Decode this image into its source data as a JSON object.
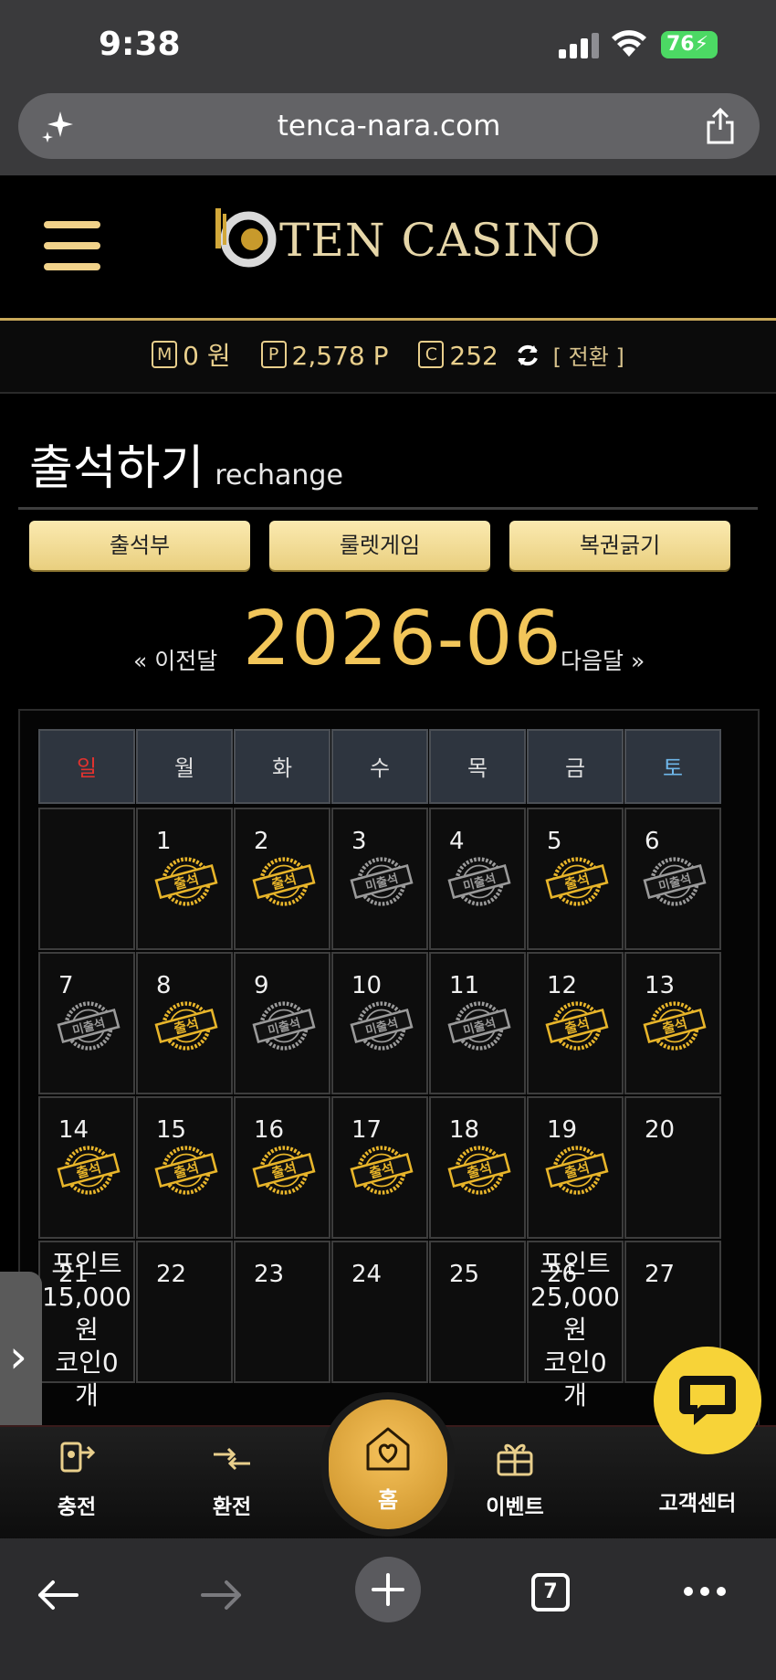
{
  "status": {
    "time": "9:38",
    "battery": "76"
  },
  "browser": {
    "url": "tenca-nara.com",
    "tab_count": "7"
  },
  "header": {
    "logo_text": "TEN CASINO"
  },
  "balance": {
    "money_label": "M",
    "money": "0 원",
    "point_label": "P",
    "points": "2,578 P",
    "coin_label": "C",
    "coins": "252",
    "convert": "[ 전환 ]"
  },
  "page": {
    "title": "출석하기",
    "subtitle": "rechange"
  },
  "tabs": [
    {
      "label": "출석부"
    },
    {
      "label": "룰렛게임"
    },
    {
      "label": "복권긁기"
    }
  ],
  "month_nav": {
    "prev": "« 이전달",
    "current": "2026-06",
    "next": "다음달 »"
  },
  "calendar": {
    "weekdays": [
      "일",
      "월",
      "화",
      "수",
      "목",
      "금",
      "토"
    ],
    "weekday_colors": [
      "#e0322f",
      "#dddddd",
      "#dddddd",
      "#dddddd",
      "#dddddd",
      "#dddddd",
      "#6fb7ea"
    ],
    "attended_label": "출석",
    "absent_label": "미출석",
    "weeks": [
      [
        {
          "day": ""
        },
        {
          "day": "1",
          "status": "attended"
        },
        {
          "day": "2",
          "status": "attended"
        },
        {
          "day": "3",
          "status": "absent"
        },
        {
          "day": "4",
          "status": "absent"
        },
        {
          "day": "5",
          "status": "attended"
        },
        {
          "day": "6",
          "status": "absent"
        }
      ],
      [
        {
          "day": "7",
          "status": "absent"
        },
        {
          "day": "8",
          "status": "attended"
        },
        {
          "day": "9",
          "status": "absent"
        },
        {
          "day": "10",
          "status": "absent"
        },
        {
          "day": "11",
          "status": "absent"
        },
        {
          "day": "12",
          "status": "attended"
        },
        {
          "day": "13",
          "status": "attended"
        }
      ],
      [
        {
          "day": "14",
          "status": "attended"
        },
        {
          "day": "15",
          "status": "attended"
        },
        {
          "day": "16",
          "status": "attended"
        },
        {
          "day": "17",
          "status": "attended"
        },
        {
          "day": "18",
          "status": "attended"
        },
        {
          "day": "19",
          "status": "attended"
        },
        {
          "day": "20"
        }
      ],
      [
        {
          "day": "21",
          "note": [
            "포인트",
            "15,000",
            "원",
            "코인0 개"
          ]
        },
        {
          "day": "22"
        },
        {
          "day": "23"
        },
        {
          "day": "24"
        },
        {
          "day": "25"
        },
        {
          "day": "26",
          "note": [
            "포인트",
            "25,000",
            "원",
            "코인0",
            "개"
          ]
        },
        {
          "day": "27"
        }
      ]
    ]
  },
  "bottom_nav": [
    {
      "label": "충전",
      "icon": "deposit-icon"
    },
    {
      "label": "환전",
      "icon": "exchange-icon"
    },
    {
      "label": "홈",
      "icon": "home-heart-icon"
    },
    {
      "label": "이벤트",
      "icon": "gift-icon"
    },
    {
      "label": "고객센터",
      "icon": "support-icon"
    }
  ],
  "colors": {
    "gold": "#f2c65a",
    "accent": "#e9cf8c",
    "button": "#f1dc97"
  }
}
